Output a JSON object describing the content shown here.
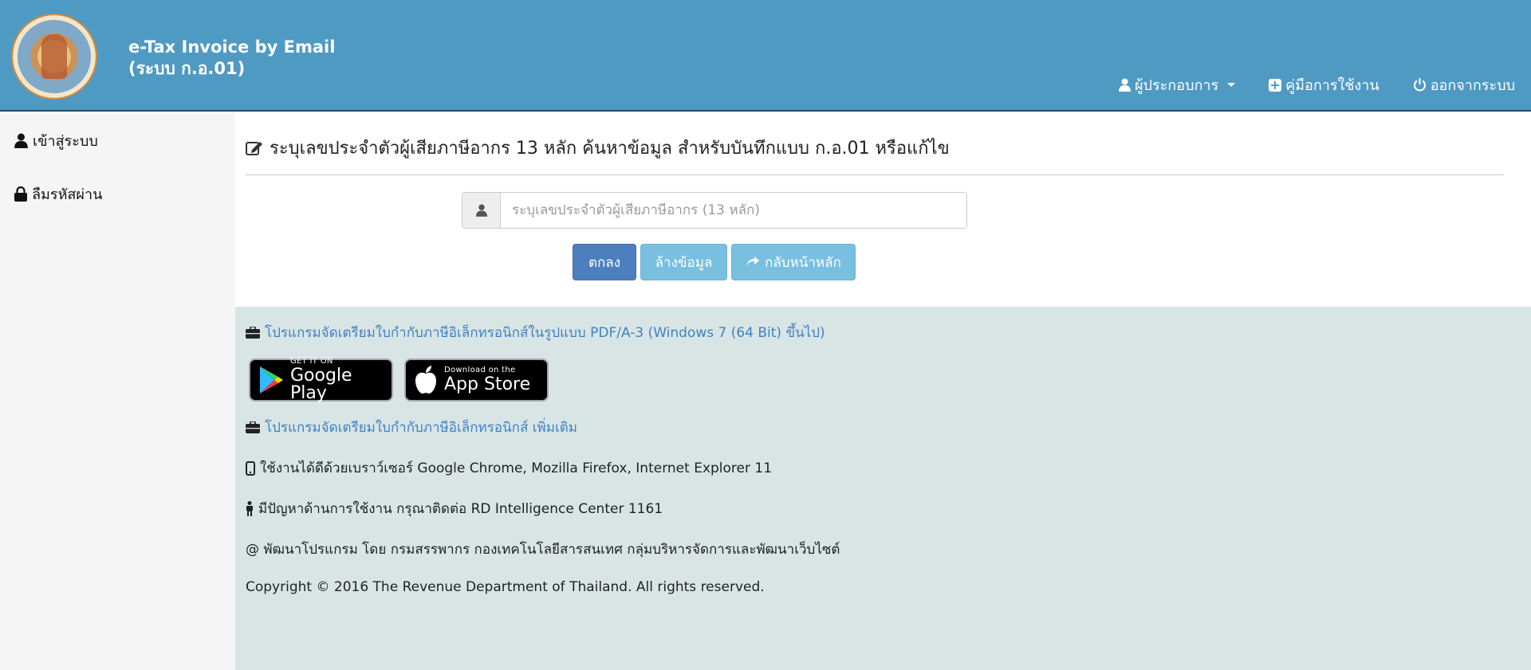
{
  "header": {
    "title_line1": "e-Tax Invoice by Email",
    "title_line2": "(ระบบ ก.อ.01)",
    "nav": [
      {
        "label": "ผู้ประกอบการ",
        "icon": "user-icon",
        "has_dropdown": true
      },
      {
        "label": "คู่มือการใช้งาน",
        "icon": "plus-square-icon"
      },
      {
        "label": "ออกจากระบบ",
        "icon": "power-icon"
      }
    ]
  },
  "sidebar": {
    "items": [
      {
        "label": "เข้าสู่ระบบ",
        "icon": "user-icon"
      },
      {
        "label": "ลืมรหัสผ่าน",
        "icon": "lock-icon"
      }
    ]
  },
  "main": {
    "title": "ระบุเลขประจำตัวผู้เสียภาษีอากร 13 หลัก ค้นหาข้อมูล สำหรับบันทึกแบบ ก.อ.01 หรือแก้ไข",
    "input": {
      "value": "",
      "placeholder": "ระบุเลขประจำตัวผู้เสียภาษีอากร (13 หลัก)"
    },
    "buttons": {
      "ok": "ตกลง",
      "clear": "ล้างข้อมูล",
      "home": "กลับหน้าหลัก"
    }
  },
  "footer": {
    "link_pdf": "โปรแกรมจัดเตรียมใบกำกับภาษีอิเล็กทรอนิกส์ในรูปแบบ PDF/A-3 (Windows 7 (64 Bit) ขึ้นไป)",
    "google_play": {
      "small": "GET IT ON",
      "big": "Google Play"
    },
    "app_store": {
      "small": "Download on the",
      "big": "App Store"
    },
    "link_more": "โปรแกรมจัดเตรียมใบกำกับภาษีอิเล็กทรอนิกส์ เพิ่มเติม",
    "browsers": "ใช้งานได้ดีด้วยเบราว์เซอร์ Google Chrome, Mozilla Firefox, Internet Explorer 11",
    "support": "มีปัญหาด้านการใช้งาน กรุณาติดต่อ RD Intelligence Center 1161",
    "developer": "@ พัฒนาโปรแกรม โดย กรมสรรพากร กองเทคโนโลยีสารสนเทศ กลุ่มบริหารจัดการและพัฒนาเว็บไซต์",
    "copyright": "Copyright © 2016 The Revenue Department of Thailand. All rights reserved."
  },
  "colors": {
    "header_bg": "#4f9ac3",
    "primary": "#4d7fbf",
    "info": "#78bfe0",
    "link": "#3f82c4",
    "footer_bg": "#d8e5e4"
  }
}
